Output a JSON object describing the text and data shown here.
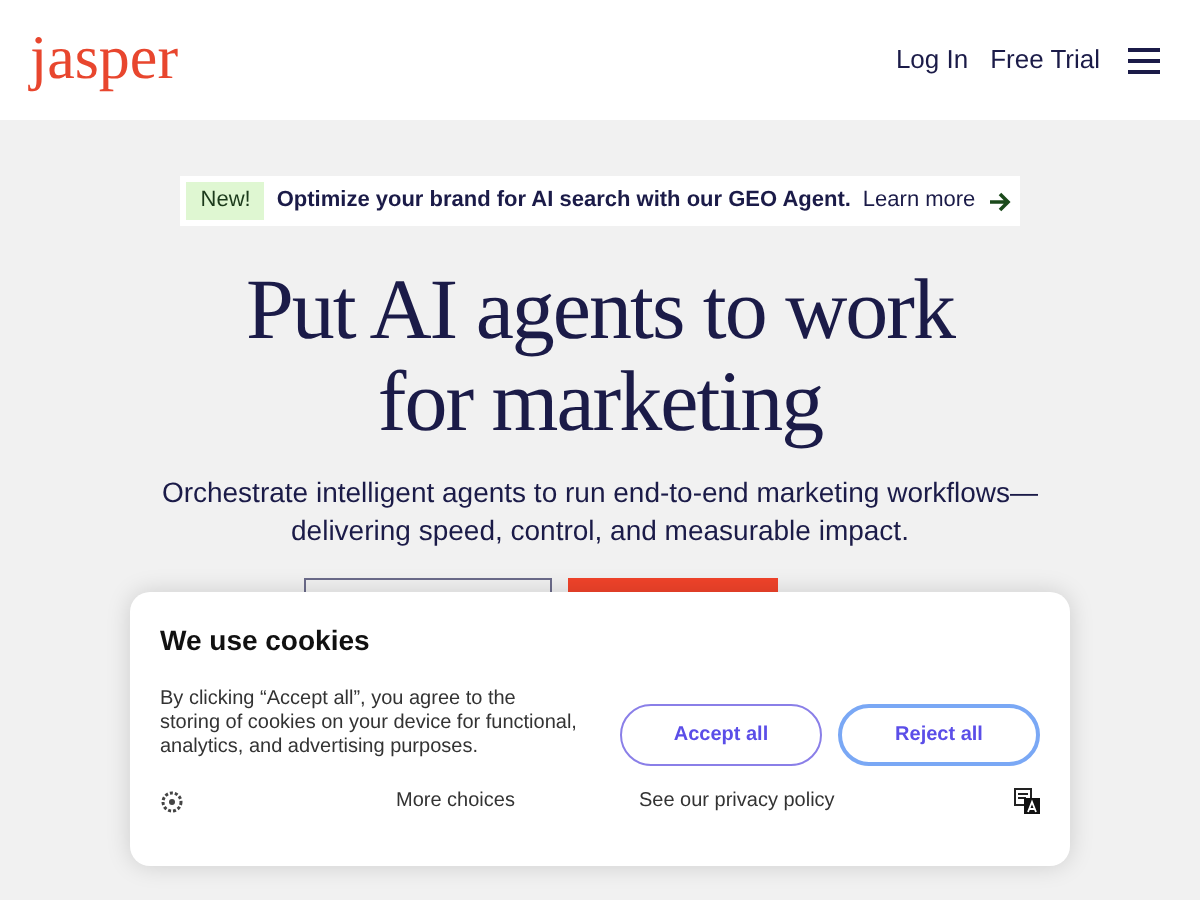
{
  "header": {
    "logo": "jasper",
    "nav": [
      "Log In",
      "Free Trial"
    ]
  },
  "banner": {
    "badge": "New!",
    "text": "Optimize your brand for AI search with our GEO Agent.",
    "link": "Learn more"
  },
  "hero": {
    "title_lines": [
      "Put AI agents to work",
      "for marketing"
    ],
    "subtitle": "Orchestrate intelligent agents to run end-to-end marketing workflows—delivering speed, control, and measurable impact."
  },
  "cookie_dialog": {
    "title": "We use cookies",
    "body": "By clicking “Accept all”, you agree to the storing of cookies on your device for functional, analytics, and advertising purposes.",
    "buttons": [
      {
        "label": "Accept all",
        "selected": false
      },
      {
        "label": "Reject all",
        "selected": true
      }
    ],
    "links": [
      "More choices",
      "See our privacy policy"
    ]
  }
}
